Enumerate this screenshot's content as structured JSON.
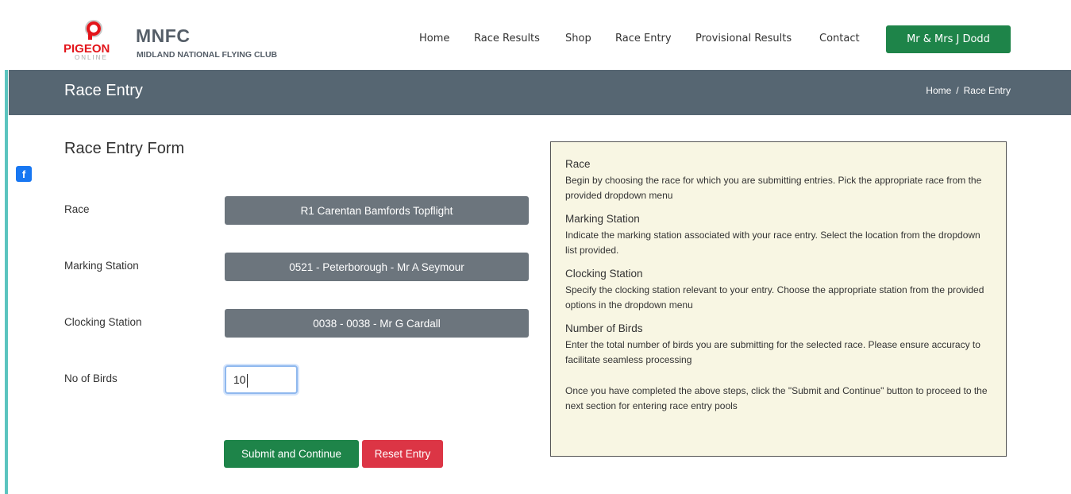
{
  "brand": {
    "logo_text": "PIGEON",
    "logo_sub": "ONLINE",
    "title": "MNFC",
    "subtitle": "MIDLAND NATIONAL FLYING CLUB"
  },
  "nav": {
    "items": [
      "Home",
      "Race Results",
      "Shop",
      "Race Entry",
      "Provisional Results",
      "Contact"
    ],
    "user_button": "Mr & Mrs J Dodd"
  },
  "page": {
    "title": "Race Entry",
    "breadcrumb": [
      "Home",
      "Race Entry"
    ],
    "breadcrumb_sep": "/"
  },
  "social": {
    "facebook": "f"
  },
  "form": {
    "title": "Race Entry Form",
    "race_label": "Race",
    "race_value": "R1 Carentan Bamfords Topflight",
    "marking_label": "Marking Station",
    "marking_value": "0521 - Peterborough - Mr A Seymour",
    "clocking_label": "Clocking Station",
    "clocking_value": "0038 - 0038 - Mr G Cardall",
    "birds_label": "No of Birds",
    "birds_value": "10",
    "submit_label": "Submit and Continue",
    "reset_label": "Reset Entry"
  },
  "help": {
    "sections": [
      {
        "heading": "Race",
        "text": "Begin by choosing the race for which you are submitting entries. Pick the appropriate race from the provided dropdown menu"
      },
      {
        "heading": "Marking Station",
        "text": "Indicate the marking station associated with your race entry. Select the location from the dropdown list provided."
      },
      {
        "heading": "Clocking Station",
        "text": "Specify the clocking station relevant to your entry. Choose the appropriate station from the provided options in the dropdown menu"
      },
      {
        "heading": "Number of Birds",
        "text": "Enter the total number of birds you are submitting for the selected race. Please ensure accuracy to facilitate seamless processing"
      }
    ],
    "final": "Once you have completed the above steps, click the \"Submit and Continue\" button to proceed to the next section for entering race entry pools"
  },
  "colors": {
    "accent_green": "#1e8449",
    "danger_red": "#dc3545",
    "title_bar": "#566672",
    "select_gray": "#6c757d",
    "help_bg": "#f8f6e3",
    "logo_red": "#e3151b"
  }
}
